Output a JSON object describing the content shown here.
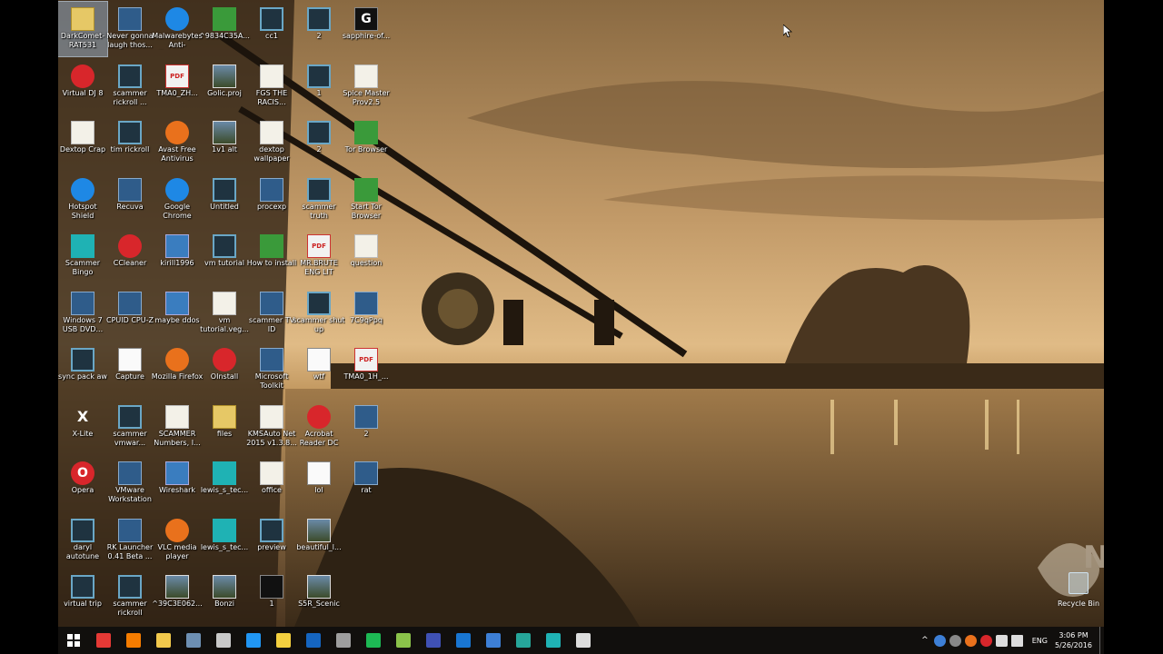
{
  "desktop": {
    "icons": [
      {
        "label": "DarkComet-RAT531",
        "kind": "folder",
        "selected": true
      },
      {
        "label": "Virtual DJ 8",
        "kind": "red"
      },
      {
        "label": "Dextop Crap",
        "kind": "doc"
      },
      {
        "label": "Hotspot Shield",
        "kind": "blue"
      },
      {
        "label": "Scammer Bingo",
        "kind": "teal"
      },
      {
        "label": "Windows 7 USB DVD...",
        "kind": "app"
      },
      {
        "label": "sync pack aw",
        "kind": "film"
      },
      {
        "label": "X-Lite",
        "kind": "xlite",
        "glyph": "X"
      },
      {
        "label": "Opera",
        "kind": "red",
        "glyph": "O"
      },
      {
        "label": "daryl autotune",
        "kind": "film"
      },
      {
        "label": "virtual trip",
        "kind": "film"
      },
      {
        "label": "Never gonna laugh thos...",
        "kind": "app"
      },
      {
        "label": "scammer rickroll ...",
        "kind": "film"
      },
      {
        "label": "tim rickroll",
        "kind": "film"
      },
      {
        "label": "Recuva",
        "kind": "app"
      },
      {
        "label": "CCleaner",
        "kind": "red"
      },
      {
        "label": "CPUID CPU-Z",
        "kind": "app"
      },
      {
        "label": "Capture",
        "kind": "white"
      },
      {
        "label": "scammer vmwar...",
        "kind": "film"
      },
      {
        "label": "VMware Workstation",
        "kind": "app"
      },
      {
        "label": "RK Launcher 0.41 Beta ...",
        "kind": "app"
      },
      {
        "label": "scammer rickroll",
        "kind": "film"
      },
      {
        "label": "Malwarebytes Anti-Ransom...",
        "kind": "blue"
      },
      {
        "label": "TMA0_ZH...",
        "kind": "pdf",
        "glyph": "PDF"
      },
      {
        "label": "Avast Free Antivirus",
        "kind": "orange"
      },
      {
        "label": "Google Chrome",
        "kind": "blue"
      },
      {
        "label": "kirill1996",
        "kind": "exe"
      },
      {
        "label": "maybe ddos",
        "kind": "exe"
      },
      {
        "label": "Mozilla Firefox",
        "kind": "orange"
      },
      {
        "label": "SCAMMER Numbers, I...",
        "kind": "doc"
      },
      {
        "label": "Wireshark",
        "kind": "exe"
      },
      {
        "label": "VLC media player",
        "kind": "orange"
      },
      {
        "label": "^39C3E062...",
        "kind": "img"
      },
      {
        "label": "^9834C35A...",
        "kind": "green"
      },
      {
        "label": "Golic.proj",
        "kind": "img"
      },
      {
        "label": "1v1 alt",
        "kind": "img"
      },
      {
        "label": "Untitled",
        "kind": "film"
      },
      {
        "label": "vm tutorial",
        "kind": "film"
      },
      {
        "label": "vm tutorial.veg...",
        "kind": "doc"
      },
      {
        "label": "OInstall",
        "kind": "red"
      },
      {
        "label": "files",
        "kind": "folder"
      },
      {
        "label": "lewis_s_tec...",
        "kind": "teal"
      },
      {
        "label": "lewis_s_tec...",
        "kind": "teal"
      },
      {
        "label": "Bonzi",
        "kind": "img"
      },
      {
        "label": "cc1",
        "kind": "film"
      },
      {
        "label": "FGS THE RACIS...",
        "kind": "doc"
      },
      {
        "label": "dextop wallpaper",
        "kind": "doc"
      },
      {
        "label": "procexp",
        "kind": "app"
      },
      {
        "label": "How to install",
        "kind": "green"
      },
      {
        "label": "scammer TV ID",
        "kind": "app"
      },
      {
        "label": "Microsoft Toolkit",
        "kind": "app"
      },
      {
        "label": "KMSAuto Net 2015 v1.3.8...",
        "kind": "doc"
      },
      {
        "label": "office",
        "kind": "doc"
      },
      {
        "label": "preview",
        "kind": "film"
      },
      {
        "label": "1",
        "kind": "dark"
      },
      {
        "label": "2",
        "kind": "film"
      },
      {
        "label": "1",
        "kind": "film"
      },
      {
        "label": "2",
        "kind": "film"
      },
      {
        "label": "scammer truth",
        "kind": "film"
      },
      {
        "label": "MR.BRUTE ENG LIT",
        "kind": "pdf",
        "glyph": "PDF"
      },
      {
        "label": "scammer shut up",
        "kind": "film"
      },
      {
        "label": "wtf",
        "kind": "white"
      },
      {
        "label": "Acrobat Reader DC",
        "kind": "red"
      },
      {
        "label": "lol",
        "kind": "white"
      },
      {
        "label": "beautiful_l...",
        "kind": "img"
      },
      {
        "label": "S5R_Scenic",
        "kind": "img"
      },
      {
        "label": "sapphire-of...",
        "kind": "dark",
        "glyph": "G"
      },
      {
        "label": "Spice Master Prov2.5",
        "kind": "doc"
      },
      {
        "label": "Tor Browser",
        "kind": "green"
      },
      {
        "label": "Start Tor Browser",
        "kind": "green"
      },
      {
        "label": "question",
        "kind": "doc"
      },
      {
        "label": "7C9qPpq",
        "kind": "app"
      },
      {
        "label": "TMA0_1H_...",
        "kind": "pdf",
        "glyph": "PDF"
      },
      {
        "label": "2",
        "kind": "app"
      },
      {
        "label": "rat",
        "kind": "app"
      }
    ],
    "recycle_bin_label": "Recycle Bin",
    "watermark_text": "NASH"
  },
  "taskbar": {
    "pinned": [
      {
        "name": "chrome",
        "color": "#e53935"
      },
      {
        "name": "firefox",
        "color": "#f57c00"
      },
      {
        "name": "file-explorer",
        "color": "#f2c94c"
      },
      {
        "name": "media",
        "color": "#6d8fb3"
      },
      {
        "name": "paint",
        "color": "#c9c9c9"
      },
      {
        "name": "skype",
        "color": "#2196f3"
      },
      {
        "name": "app",
        "color": "#f4d03f"
      },
      {
        "name": "wireshark",
        "color": "#1565c0"
      },
      {
        "name": "calculator",
        "color": "#9e9e9e"
      },
      {
        "name": "spotify",
        "color": "#1db954"
      },
      {
        "name": "notepad",
        "color": "#8bc34a"
      },
      {
        "name": "browser",
        "color": "#3f51b5"
      },
      {
        "name": "outlook",
        "color": "#1976d2"
      },
      {
        "name": "malwarebytes",
        "color": "#3d7fd6"
      },
      {
        "name": "chat",
        "color": "#26a69a"
      },
      {
        "name": "teal-app",
        "color": "#1fb2b4"
      },
      {
        "name": "xlite",
        "color": "#dddddd"
      }
    ],
    "language": "ENG",
    "time": "3:06 PM",
    "date": "5/26/2016"
  }
}
